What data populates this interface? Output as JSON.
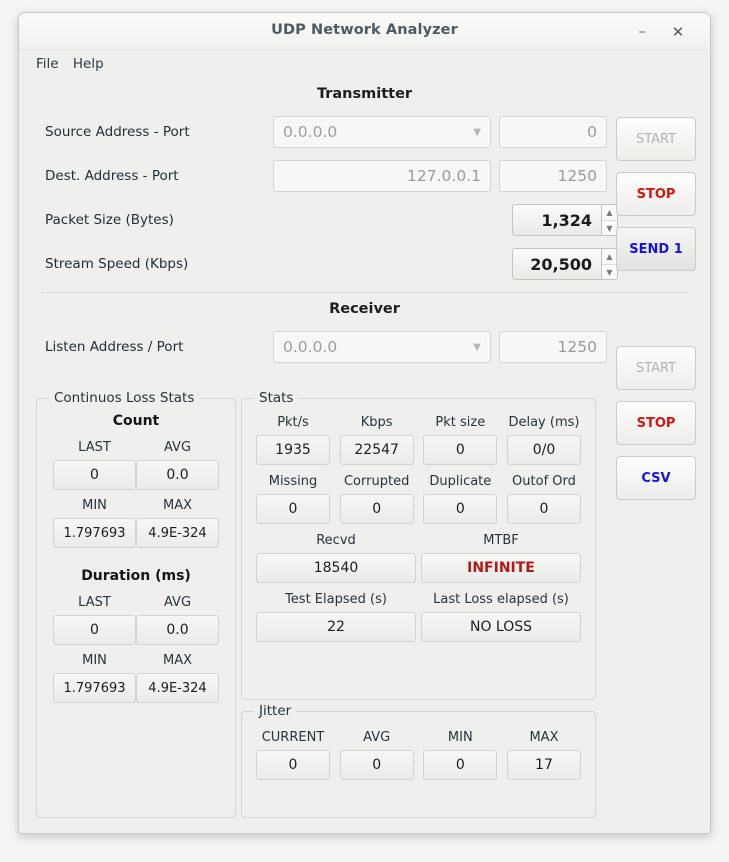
{
  "window": {
    "title": "UDP Network Analyzer",
    "minimize_icon": "minimize-icon",
    "close_icon": "close-icon"
  },
  "menubar": {
    "items": [
      "File",
      "Help"
    ]
  },
  "transmitter": {
    "heading": "Transmitter",
    "rows": [
      {
        "label": "Source Address - Port",
        "address": "0.0.0.0",
        "port": "0"
      },
      {
        "label": "Dest. Address - Port",
        "address": "127.0.0.1",
        "port": "1250"
      }
    ],
    "packet_size": {
      "label": "Packet Size (Bytes)",
      "value": "1,324"
    },
    "stream_speed": {
      "label": "Stream Speed (Kbps)",
      "value": "20,500"
    },
    "buttons": [
      {
        "label": "START",
        "state": "disabled",
        "color": "#b3b3b1"
      },
      {
        "label": "STOP",
        "state": "enabled",
        "color": "#d6170e"
      },
      {
        "label": "SEND 1",
        "state": "enabled",
        "color": "#1414e0"
      }
    ]
  },
  "receiver": {
    "heading": "Receiver",
    "listen": {
      "label": "Listen Address / Port",
      "address": "0.0.0.0",
      "port": "1250"
    },
    "buttons": [
      {
        "label": "START",
        "state": "disabled",
        "color": "#b3b3b1"
      },
      {
        "label": "STOP",
        "state": "enabled",
        "color": "#d6170e"
      },
      {
        "label": "CSV",
        "state": "enabled",
        "color": "#1414e0"
      }
    ]
  },
  "continuous_loss_stats": {
    "title": "Continuos Loss Stats",
    "count": {
      "heading": "Count",
      "last_label": "LAST",
      "last_value": "0",
      "avg_label": "AVG",
      "avg_value": "0.0",
      "min_label": "MIN",
      "min_value": "1.797693",
      "max_label": "MAX",
      "max_value": "4.9E-324"
    },
    "duration": {
      "heading": "Duration (ms)",
      "last_label": "LAST",
      "last_value": "0",
      "avg_label": "AVG",
      "avg_value": "0.0",
      "min_label": "MIN",
      "min_value": "1.797693",
      "max_label": "MAX",
      "max_value": "4.9E-324"
    }
  },
  "stats": {
    "title": "Stats",
    "row1": [
      {
        "label": "Pkt/s",
        "value": "1935"
      },
      {
        "label": "Kbps",
        "value": "22547"
      },
      {
        "label": "Pkt size",
        "value": "0"
      },
      {
        "label": "Delay (ms)",
        "value": "0/0"
      }
    ],
    "row2": [
      {
        "label": "Missing",
        "value": "0"
      },
      {
        "label": "Corrupted",
        "value": "0"
      },
      {
        "label": "Duplicate",
        "value": "0"
      },
      {
        "label": "Outof Ord",
        "value": "0"
      }
    ],
    "row3": [
      {
        "label": "Recvd",
        "value": "18540"
      },
      {
        "label": "MTBF",
        "value": "INFINITE",
        "highlight": true
      }
    ],
    "row4": [
      {
        "label": "Test Elapsed (s)",
        "value": "22"
      },
      {
        "label": "Last Loss elapsed (s)",
        "value": "NO LOSS"
      }
    ]
  },
  "jitter": {
    "title": "Jitter",
    "cells": [
      {
        "label": "CURRENT",
        "value": "0"
      },
      {
        "label": "AVG",
        "value": "0"
      },
      {
        "label": "MIN",
        "value": "0"
      },
      {
        "label": "MAX",
        "value": "17"
      }
    ]
  }
}
